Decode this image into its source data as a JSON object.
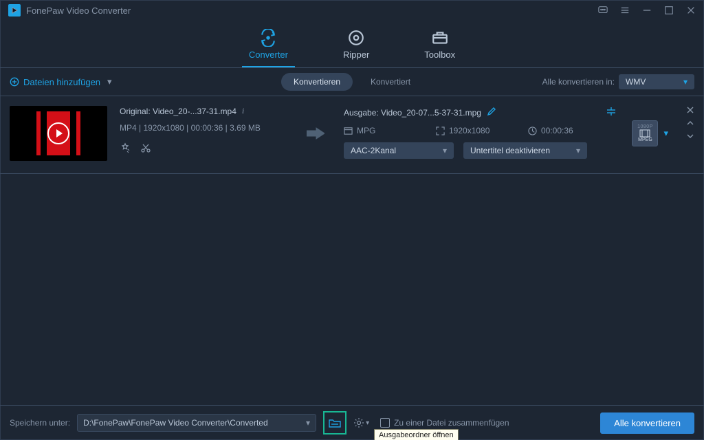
{
  "titlebar": {
    "title": "FonePaw Video Converter"
  },
  "nav": {
    "tabs": [
      {
        "label": "Converter"
      },
      {
        "label": "Ripper"
      },
      {
        "label": "Toolbox"
      }
    ]
  },
  "actionbar": {
    "add_files": "Dateien hinzufügen",
    "seg": [
      {
        "label": "Konvertieren"
      },
      {
        "label": "Konvertiert"
      }
    ],
    "convert_all_in": "Alle konvertieren in:",
    "format": "WMV"
  },
  "item": {
    "original_prefix": "Original: ",
    "original_name": "Video_20-...37-31.mp4",
    "specs": "MP4 | 1920x1080 | 00:00:36 | 3.69 MB",
    "output_prefix": "Ausgabe: ",
    "output_name": "Video_20-07...5-37-31.mpg",
    "out_format": "MPG",
    "out_res": "1920x1080",
    "out_dur": "00:00:36",
    "audio": "AAC-2Kanal",
    "subtitle": "Untertitel deaktivieren",
    "preset_top": "1080P",
    "preset_mid": "MPEG"
  },
  "footer": {
    "save_label": "Speichern unter:",
    "path": "D:\\FonePaw\\FonePaw Video Converter\\Converted",
    "merge": "Zu einer Datei zusammenfügen",
    "convert_all": "Alle konvertieren",
    "tooltip": "Ausgabeordner öffnen"
  }
}
